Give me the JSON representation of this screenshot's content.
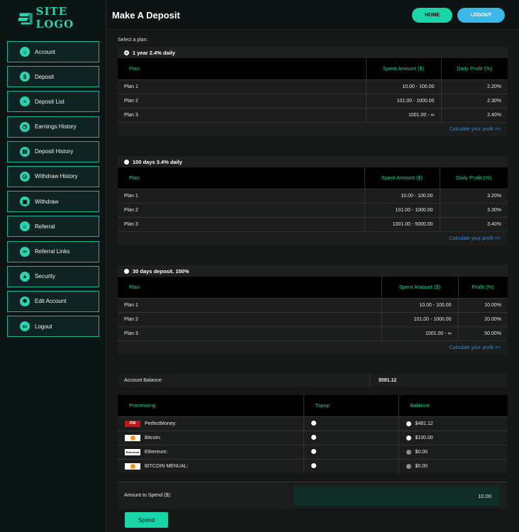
{
  "logo": {
    "text": "SITE LOGO"
  },
  "sidebar": {
    "items": [
      {
        "label": "Account",
        "icon": "home-icon",
        "glyph": "⌂"
      },
      {
        "label": "Deposit",
        "icon": "dollar-icon",
        "glyph": "$"
      },
      {
        "label": "Deposit List",
        "icon": "list-icon",
        "glyph": "≡"
      },
      {
        "label": "Earnings History",
        "icon": "clock-icon",
        "glyph": "◷"
      },
      {
        "label": "Deposit History",
        "icon": "chart-icon",
        "glyph": "▤"
      },
      {
        "label": "Withdraw History",
        "icon": "history-icon",
        "glyph": "◶"
      },
      {
        "label": "Withdraw",
        "icon": "wallet-icon",
        "glyph": "▣"
      },
      {
        "label": "Referral",
        "icon": "users-icon",
        "glyph": "☺"
      },
      {
        "label": "Referral Links",
        "icon": "link-icon",
        "glyph": "∞"
      },
      {
        "label": "Security",
        "icon": "lock-icon",
        "glyph": "▲"
      },
      {
        "label": "Edit Account",
        "icon": "gear-icon",
        "glyph": "✱"
      },
      {
        "label": "Logout",
        "icon": "logout-icon",
        "glyph": "⇦"
      }
    ]
  },
  "header": {
    "title": "Make A Deposit",
    "home": "HOME",
    "logout": "LOGOUT"
  },
  "main": {
    "select_label": "Select a plan:",
    "plans": [
      {
        "name": "1 year 2.4% daily",
        "selected": true,
        "headers": [
          "Plan",
          "Spent Amount ($)",
          "Daily Profit (%)"
        ],
        "rows": [
          [
            "Plan 1",
            "10.00 - 100.00",
            "2.20%"
          ],
          [
            "Plan 2",
            "101.00 - 1000.00",
            "2.30%"
          ],
          [
            "Plan 3",
            "1001.00 - ∞",
            "2.40%"
          ]
        ],
        "calc": "Calculate your profit >>"
      },
      {
        "name": "100 days 3.4% daily",
        "selected": false,
        "headers": [
          "Plan",
          "Spent Amount ($)",
          "Daily Profit (%)"
        ],
        "rows": [
          [
            "Plan 1",
            "10.00 - 100.00",
            "3.20%"
          ],
          [
            "Plan 2",
            "101.00 - 1000.00",
            "3.30%"
          ],
          [
            "Plan 3",
            "1001.00 - 5000.00",
            "3.40%"
          ]
        ],
        "calc": "Calculate your profit >>"
      },
      {
        "name": "30 days deposit. 150%",
        "selected": false,
        "headers": [
          "Plan",
          "Spent Amount ($)",
          "Profit (%)"
        ],
        "rows": [
          [
            "Plan 1",
            "10.00 - 100.00",
            "10.00%"
          ],
          [
            "Plan 2",
            "101.00 - 1000.00",
            "20.00%"
          ],
          [
            "Plan 3",
            "1001.00 - ∞",
            "50.00%"
          ]
        ],
        "calc": "Calculate your profit >>"
      }
    ],
    "balance": {
      "label": "Account Balance:",
      "value": "$581.12"
    },
    "processing": {
      "headers": [
        "Processing",
        "Topup",
        "Balance"
      ],
      "rows": [
        {
          "name": "PerfectMoney:",
          "icon": "perfectmoney-icon",
          "icon_text": "PM",
          "balance": "$481.12",
          "balance_enabled": true
        },
        {
          "name": "Bitcoin:",
          "icon": "bitcoin-icon",
          "icon_text": "",
          "balance": "$100.00",
          "balance_enabled": true
        },
        {
          "name": "Ethereum:",
          "icon": "ethereum-icon",
          "icon_text": "Ethereum",
          "balance": "$0.00",
          "balance_enabled": false
        },
        {
          "name": "BITCOIN MENUAL:",
          "icon": "bitcoin-icon",
          "icon_text": "",
          "balance": "$0.00",
          "balance_enabled": false
        }
      ]
    },
    "spend": {
      "label": "Amount to Spend ($):",
      "value": "10.00",
      "button": "Spend"
    }
  }
}
